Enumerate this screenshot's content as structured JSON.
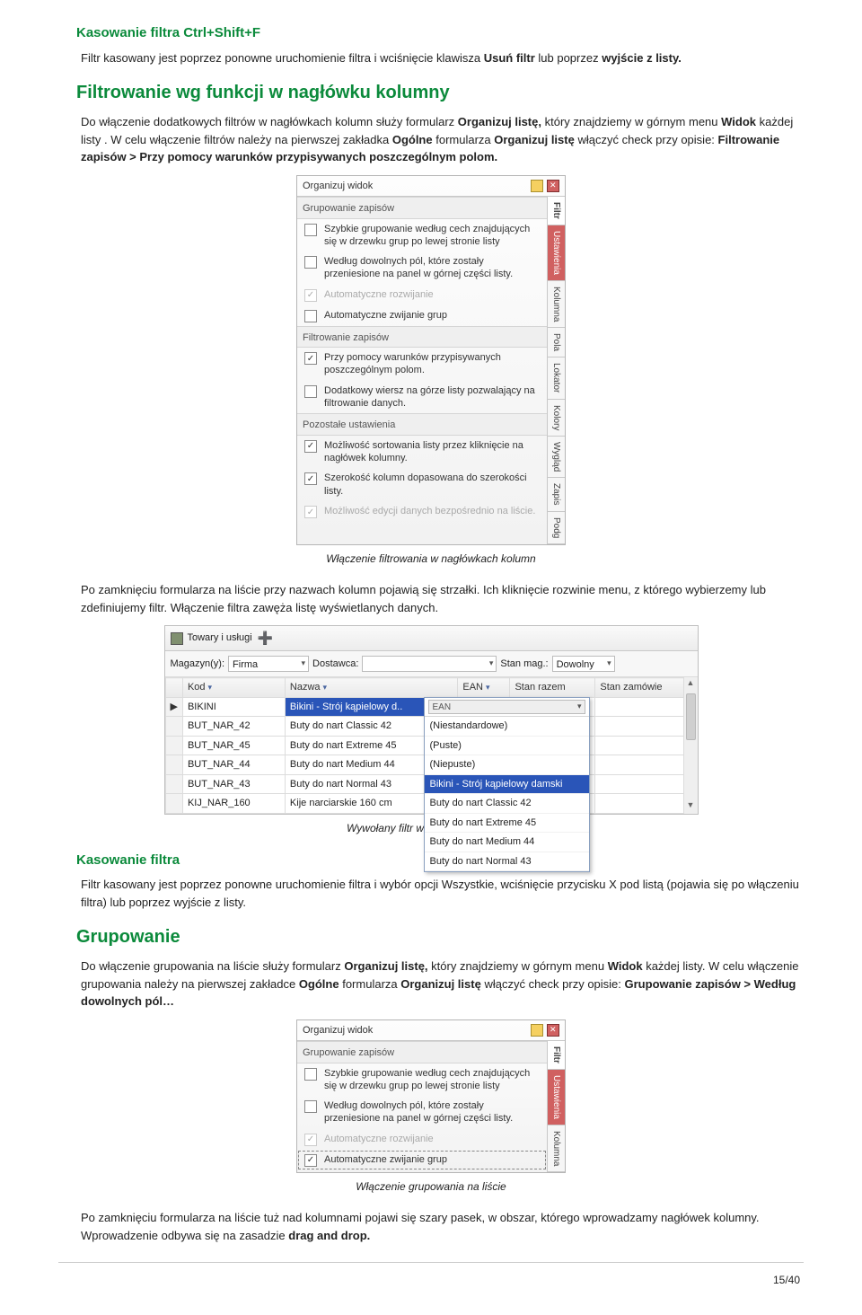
{
  "headings": {
    "h1": "Kasowanie filtra Ctrl+Shift+F",
    "h2": "Filtrowanie wg funkcji w nagłówku kolumny",
    "h3": "Kasowanie filtra",
    "h4": "Grupowanie"
  },
  "para": {
    "p1a": "Filtr kasowany jest poprzez ponowne uruchomienie filtra i wciśnięcie klawisza ",
    "p1b": "Usuń filtr",
    "p1c": " lub poprzez ",
    "p1d": "wyjście z listy.",
    "p2a": "Do włączenie dodatkowych filtrów w nagłówkach kolumn służy formularz ",
    "p2b": "Organizuj listę,",
    "p2c": " który znajdziemy w górnym menu ",
    "p2d": "Widok",
    "p2e": " każdej listy",
    "p2f": ". W celu włączenie filtrów należy na pierwszej zakładka ",
    "p2g": "Ogólne",
    "p2h": " formularza ",
    "p2i": "Organizuj listę",
    "p2j": " włączyć check przy opisie: ",
    "p2k": "Filtrowanie zapisów > Przy pomocy warunków przypisywanych poszczególnym polom.",
    "p3": "Po zamknięciu formularza na liście przy nazwach kolumn pojawią się strzałki. Ich kliknięcie rozwinie menu, z którego wybierzemy lub zdefiniujemy filtr. Włączenie filtra zawęża listę wyświetlanych danych.",
    "p4": "Filtr kasowany jest poprzez ponowne uruchomienie filtra i wybór opcji Wszystkie, wciśnięcie przycisku X pod listą (pojawia się po włączeniu filtra) lub poprzez wyjście z listy.",
    "p5a": "Do włączenie grupowania na liście służy formularz ",
    "p5b": "Organizuj listę,",
    "p5c": " który znajdziemy w górnym menu ",
    "p5d": "Widok",
    "p5e": " każdej listy. W celu włączenie grupowania należy na pierwszej zakładce ",
    "p5f": "Ogólne",
    "p5g": " formularza ",
    "p5h": "Organizuj listę",
    "p5i": " włączyć check przy opisie: ",
    "p5j": "Grupowanie zapisów > Według dowolnych pól…",
    "p6a": "Po zamknięciu formularza na liście tuż nad kolumnami pojawi się szary pasek, w obszar, którego wprowadzamy nagłówek kolumny. Wprowadzenie odbywa się na zasadzie ",
    "p6b": "drag and drop."
  },
  "captions": {
    "c1": "Włączenie filtrowania w nagłówkach kolumn",
    "c2": "Wywołany filtr w nagłówku kolumny",
    "c3": "Włączenie grupowania na liście"
  },
  "ov": {
    "title": "Organizuj widok",
    "sections": {
      "grupowanie": "Grupowanie zapisów",
      "filtrowanie": "Filtrowanie zapisów",
      "pozostale": "Pozostałe ustawienia"
    },
    "rows": {
      "r1": "Szybkie grupowanie według cech znajdujących się w drzewku grup po lewej stronie listy",
      "r2": "Według dowolnych pól, które zostały przeniesione na panel w górnej części listy.",
      "r3": "Automatyczne rozwijanie",
      "r4": "Automatyczne zwijanie grup",
      "r5": "Przy pomocy warunków przypisywanych poszczególnym polom.",
      "r6": "Dodatkowy wiersz na górze listy pozwalający na filtrowanie danych.",
      "r7": "Możliwość sortowania listy przez kliknięcie na nagłówek kolumny.",
      "r8": "Szerokość kolumn dopasowana do szerokości listy.",
      "r9": "Możliwość edycji danych bezpośrednio na liście."
    },
    "tabs": [
      "Filtr",
      "Ustawienia",
      "Kolumna",
      "Pola",
      "Lokator",
      "Kolory",
      "Wygląd",
      "Zapis",
      "Podg"
    ]
  },
  "tbl": {
    "title": "Towary i usługi",
    "filter": {
      "magazynLabel": "Magazyn(y):",
      "magazynVal": "Firma",
      "dostawcaLabel": "Dostawca:",
      "stanLabel": "Stan mag.:",
      "stanVal": "Dowolny"
    },
    "cols": {
      "kod": "Kod",
      "nazwa": "Nazwa",
      "ean": "EAN",
      "stanrazem": "Stan razem",
      "stanzam": "Stan zamówie"
    },
    "rows": [
      {
        "kod": "BIKINI",
        "nazwa": "Bikini - Strój kąpielowy d.."
      },
      {
        "kod": "BUT_NAR_42",
        "nazwa": "Buty do nart Classic 42"
      },
      {
        "kod": "BUT_NAR_45",
        "nazwa": "Buty do nart Extreme 45"
      },
      {
        "kod": "BUT_NAR_44",
        "nazwa": "Buty do nart Medium 44"
      },
      {
        "kod": "BUT_NAR_43",
        "nazwa": "Buty do nart Normal 43"
      },
      {
        "kod": "KIJ_NAR_160",
        "nazwa": "Kije narciarskie 160 cm"
      }
    ],
    "dropdown": {
      "heading": "EAN",
      "items": [
        {
          "t": "(Niestandardowe)",
          "sel": false
        },
        {
          "t": "(Puste)",
          "sel": false
        },
        {
          "t": "(Niepuste)",
          "sel": false
        },
        {
          "t": "Bikini - Strój kąpielowy damski",
          "sel": true
        },
        {
          "t": "Buty do nart Classic 42",
          "sel": false
        },
        {
          "t": "Buty do nart Extreme 45",
          "sel": false
        },
        {
          "t": "Buty do nart Medium 44",
          "sel": false
        },
        {
          "t": "Buty do nart Normal 43",
          "sel": false
        }
      ]
    }
  },
  "footer": {
    "page": "15/40"
  }
}
